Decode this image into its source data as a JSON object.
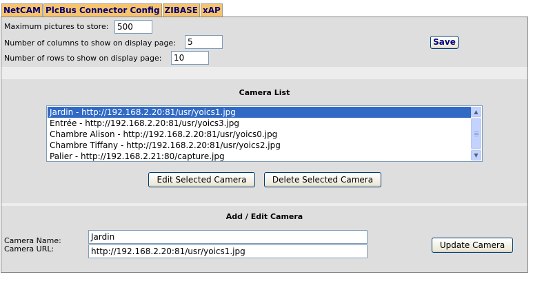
{
  "tabs": [
    {
      "label": "NetCAM"
    },
    {
      "label": "PlcBus Connector Config"
    },
    {
      "label": "ZIBASE"
    },
    {
      "label": "xAP"
    }
  ],
  "settings": {
    "max_pictures_label": "Maximum pictures to store:",
    "max_pictures_value": "500",
    "columns_label": "Number of columns to show on display page:",
    "columns_value": "5",
    "rows_label": "Number of rows to show on display page:",
    "rows_value": "10",
    "save_label": "Save"
  },
  "camera_list": {
    "title": "Camera List",
    "items": [
      {
        "label": "Jardin - http://192.168.2.20:81/usr/yoics1.jpg",
        "selected": true
      },
      {
        "label": "Entrée - http://192.168.2.20:81/usr/yoics3.jpg",
        "selected": false
      },
      {
        "label": "Chambre Alison - http://192.168.2.20:81/usr/yoics0.jpg",
        "selected": false
      },
      {
        "label": "Chambre Tiffany - http://192.168.2.20:81/usr/yoics2.jpg",
        "selected": false
      },
      {
        "label": "Palier - http://192.168.2.21:80/capture.jpg",
        "selected": false
      }
    ],
    "edit_button": "Edit Selected Camera",
    "delete_button": "Delete Selected Camera"
  },
  "add_edit": {
    "title": "Add / Edit Camera",
    "name_label": "Camera Name:",
    "name_value": "Jardin",
    "url_label": "Camera URL:",
    "url_value": "http://192.168.2.20:81/usr/yoics1.jpg",
    "update_button": "Update Camera"
  },
  "colors": {
    "tab_background": "#f7c46c",
    "tab_text": "#00007a",
    "section_background": "#dedede",
    "selection": "#316ac5"
  }
}
